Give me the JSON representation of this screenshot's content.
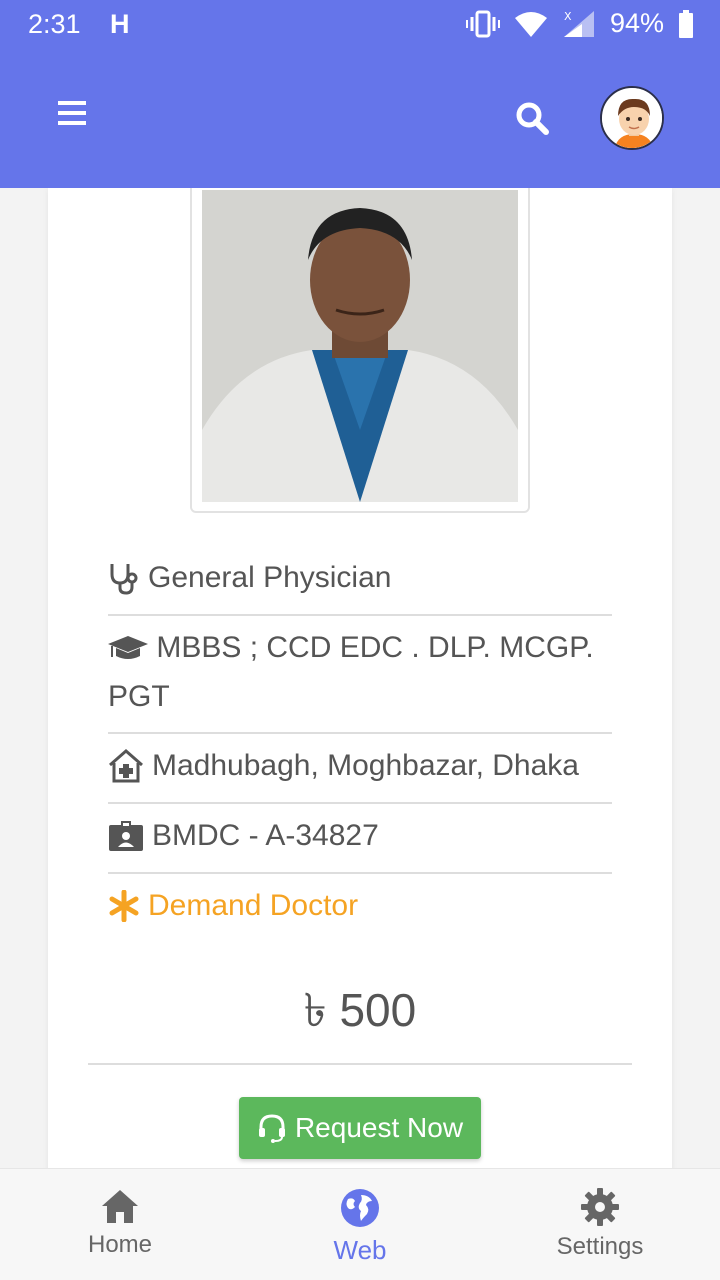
{
  "status_bar": {
    "time": "2:31",
    "network_type": "H",
    "battery": "94%"
  },
  "app_bar": {
    "menu_icon": "hamburger-menu-icon",
    "search_icon": "search-icon",
    "avatar_icon": "user-avatar-icon"
  },
  "doctor": {
    "specialty": "General Physician",
    "degrees": "MBBS ; CCD EDC . DLP. MCGP. PGT",
    "location": "Madhubagh, Moghbazar, Dhaka",
    "registration": "BMDC - A-34827",
    "tag": "Demand Doctor",
    "fee": "৳ 500"
  },
  "request_button": {
    "label": "Request Now"
  },
  "bottom_nav": {
    "items": [
      {
        "label": "Home",
        "icon": "home-icon"
      },
      {
        "label": "Web",
        "icon": "globe-icon",
        "active": true
      },
      {
        "label": "Settings",
        "icon": "gear-icon"
      }
    ]
  },
  "colors": {
    "primary": "#6575ea",
    "accent_orange": "#f5a323",
    "button_green": "#5cb85c"
  }
}
